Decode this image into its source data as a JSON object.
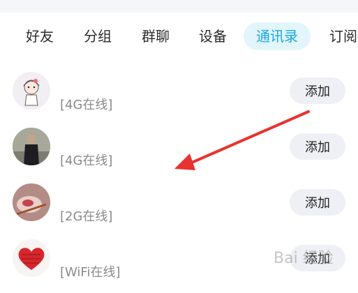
{
  "tabs": [
    {
      "label": "好友",
      "active": false
    },
    {
      "label": "分组",
      "active": false
    },
    {
      "label": "群聊",
      "active": false
    },
    {
      "label": "设备",
      "active": false
    },
    {
      "label": "通讯录",
      "active": true
    },
    {
      "label": "订阅",
      "active": false
    }
  ],
  "contacts": [
    {
      "status": "[4G在线]",
      "button": "添加",
      "avatar_icon": "cartoon-girl-avatar-icon"
    },
    {
      "status": "[4G在线]",
      "button": "添加",
      "avatar_icon": "person-photo-avatar-icon"
    },
    {
      "status": "[2G在线]",
      "button": "添加",
      "avatar_icon": "food-photo-avatar-icon"
    },
    {
      "status": "[WiFi在线]",
      "button": "添加",
      "avatar_icon": "red-heart-avatar-icon"
    }
  ],
  "colors": {
    "accent": "#18a8e0",
    "active_tab_bg": "#e2f5fb",
    "button_bg": "#eef0f5",
    "arrow": "#e8322f"
  },
  "watermark": {
    "logo_text": "Bai 经验"
  }
}
